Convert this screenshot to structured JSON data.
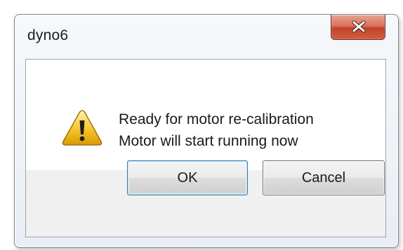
{
  "window": {
    "title": "dyno6",
    "close_label": "x"
  },
  "dialog": {
    "icon": "warning-icon",
    "message_lines": [
      "Ready for motor re-calibration",
      "Motor will start running now"
    ]
  },
  "buttons": {
    "ok_label": "OK",
    "cancel_label": "Cancel"
  },
  "colors": {
    "close_button": "#c7472d",
    "warning_fill": "#f5c52a",
    "default_button_border": "#3c7fb1"
  }
}
